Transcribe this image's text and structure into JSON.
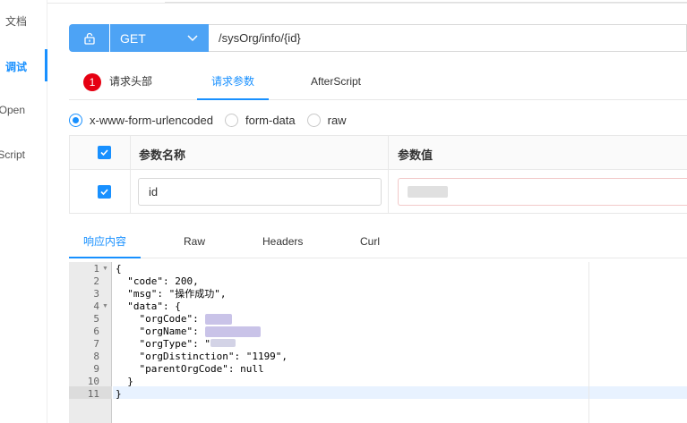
{
  "sidebar": {
    "items": [
      {
        "label": "文档",
        "active": false
      },
      {
        "label": "调试",
        "active": true
      },
      {
        "label": "Open",
        "active": false
      },
      {
        "label": "Script",
        "active": false
      }
    ]
  },
  "request": {
    "method": "GET",
    "url": "/sysOrg/info/{id}"
  },
  "request_tabs": {
    "headers_badge": "1",
    "headers_label": "请求头部",
    "params_label": "请求参数",
    "afterscript_label": "AfterScript"
  },
  "body_types": {
    "options": [
      "x-www-form-urlencoded",
      "form-data",
      "raw"
    ],
    "selected": "x-www-form-urlencoded"
  },
  "params_table": {
    "col_name": "参数名称",
    "col_value": "参数值",
    "rows": [
      {
        "checked": true,
        "name": "id",
        "value": ""
      }
    ]
  },
  "response_tabs": {
    "content_label": "响应内容",
    "raw_label": "Raw",
    "headers_label": "Headers",
    "curl_label": "Curl"
  },
  "editor": {
    "line_numbers": [
      "1",
      "2",
      "3",
      "4",
      "5",
      "6",
      "7",
      "8",
      "9",
      "10",
      "11"
    ],
    "lines": [
      "{",
      "  \"code\": 200,",
      "  \"msg\": \"操作成功\",",
      "  \"data\": {",
      "    \"orgCode\": ",
      "    \"orgName\": ",
      "    \"orgType\": \"",
      "    \"orgDistinction\": \"1199\",",
      "    \"parentOrgCode\": null",
      "  }",
      "}"
    ]
  },
  "colors": {
    "accent": "#1890ff",
    "button": "#4da3f5",
    "badge": "#e60012"
  }
}
